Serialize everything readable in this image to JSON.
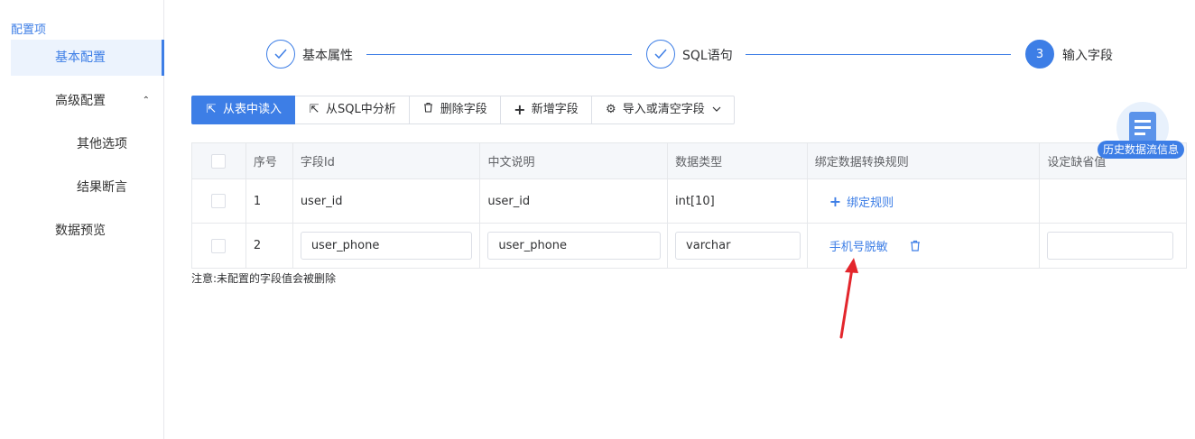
{
  "sidebar": {
    "title": "配置项",
    "items": [
      {
        "label": "基本配置"
      },
      {
        "label": "高级配置",
        "caret": "⌃"
      },
      {
        "label": "其他选项"
      },
      {
        "label": "结果断言"
      },
      {
        "label": "数据预览"
      }
    ]
  },
  "steps": [
    {
      "label": "基本属性",
      "state": "done"
    },
    {
      "label": "SQL语句",
      "state": "done"
    },
    {
      "label": "输入字段",
      "state": "active",
      "number": "3"
    }
  ],
  "toolbar": {
    "read_from_table": "从表中读入",
    "analyze_sql": "从SQL中分析",
    "delete_field": "删除字段",
    "add_field": "新增字段",
    "import_clear": "导入或清空字段"
  },
  "table": {
    "headers": [
      "序号",
      "字段Id",
      "中文说明",
      "数据类型",
      "绑定数据转换规则",
      "设定缺省值"
    ],
    "rows": [
      {
        "index": "1",
        "field_id": "user_id",
        "desc": "user_id",
        "type": "int[10]",
        "rule": "绑定规则"
      },
      {
        "index": "2",
        "field_id": "user_phone",
        "desc": "user_phone",
        "type": "varchar",
        "rule": "手机号脱敏"
      }
    ]
  },
  "note": "注意:未配置的字段值会被删除",
  "float": {
    "label": "历史数据流信息"
  },
  "colors": {
    "accent": "#3d7ee6",
    "annotation": "#e3262c"
  }
}
